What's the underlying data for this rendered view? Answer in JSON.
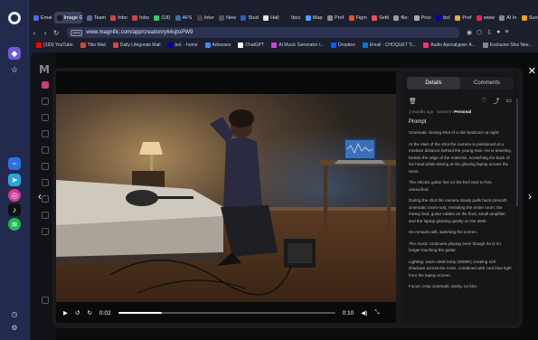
{
  "tabs": [
    {
      "label": "Emai",
      "color": "#4a6bdf"
    },
    {
      "label": "Image G",
      "color": "#1a1a1a",
      "active": true
    },
    {
      "label": "Team",
      "color": "#6264a7"
    },
    {
      "label": "Inbo",
      "color": "#d44638"
    },
    {
      "label": "Inbo",
      "color": "#d44638"
    },
    {
      "label": "(18)",
      "color": "#25d366"
    },
    {
      "label": "AFS",
      "color": "#3a6ea5"
    },
    {
      "label": "Inter",
      "color": "#444"
    },
    {
      "label": "New",
      "color": "#555"
    },
    {
      "label": "Stud",
      "color": "#2b5fb8"
    },
    {
      "label": "Hall",
      "color": "#e3e3e3"
    },
    {
      "label": "tboc",
      "color": "#222"
    },
    {
      "label": "Map",
      "color": "#4aa3ff"
    },
    {
      "label": "Prof",
      "color": "#888"
    },
    {
      "label": "Figm",
      "color": "#f24e1e"
    },
    {
      "label": "Setti",
      "color": "#ff4d4d"
    },
    {
      "label": "file:",
      "color": "#999"
    },
    {
      "label": "Prox",
      "color": "#aaa"
    },
    {
      "label": "bol",
      "color": "#0000a4"
    },
    {
      "label": "Prof",
      "color": "#e8a93a"
    },
    {
      "label": "www",
      "color": "#ee2244"
    },
    {
      "label": "AI In",
      "color": "#888"
    },
    {
      "label": "Sun",
      "color": "#f59e0b"
    }
  ],
  "url": "www.magnific.com/app/creation/y64sjtoPW9",
  "vpn_label": "VPN",
  "bookmarks": [
    {
      "label": "(193) YouTube",
      "color": "#ff0000"
    },
    {
      "label": "Tibo Mail",
      "color": "#d44638"
    },
    {
      "label": "Daily Lifegoods Mail",
      "color": "#d44638"
    },
    {
      "label": "bol. - home",
      "color": "#0000a4"
    },
    {
      "label": "Adresses",
      "color": "#4285f4"
    },
    {
      "label": "ChatGPT",
      "color": "#ffffff"
    },
    {
      "label": "AI Music Generator i...",
      "color": "#c54bd6"
    },
    {
      "label": "Dropbox",
      "color": "#0061ff"
    },
    {
      "label": "Email - CHOQUET Ti...",
      "color": "#0078d4"
    },
    {
      "label": "Audio Apocalypse: A...",
      "color": "#ff3366"
    },
    {
      "label": "Exclusive Sfxs Nee...",
      "color": "#888888"
    }
  ],
  "video": {
    "current_time": "0:02",
    "duration": "0:10",
    "progress_fraction": 0.2
  },
  "details": {
    "tab_details": "Details",
    "tab_comments": "Comments",
    "time_ago": "3 months ago",
    "saved_in_label": "Saved in",
    "saved_in_value": "Personal",
    "prompt_heading": "Prompt",
    "paragraphs": [
      "Cinematic closing shot of a dim bedroom at night.",
      "At the start of the shot the camera is positioned at a medium distance behind the young man. He is kneeling beside the edge of the mattress, scratching the back of his head while staring at the glowing laptop across the room.",
      "The electric guitar lies on the bed next to him, untouched.",
      "During the shot the camera slowly pulls back (smooth cinematic zoom-out), revealing the entire room: the messy bed, guitar cables on the floor, small amplifier, and the laptop glowing quietly on the desk.",
      "He remains still, watching the screen.",
      "The music continues playing even though he is no longer touching the guitar.",
      "Lighting: warm desk lamp (3000K) creating soft shadows across the room, combined with cool blue light from the laptop screen.",
      "Focus: crisp cinematic clarity, no blur."
    ]
  }
}
